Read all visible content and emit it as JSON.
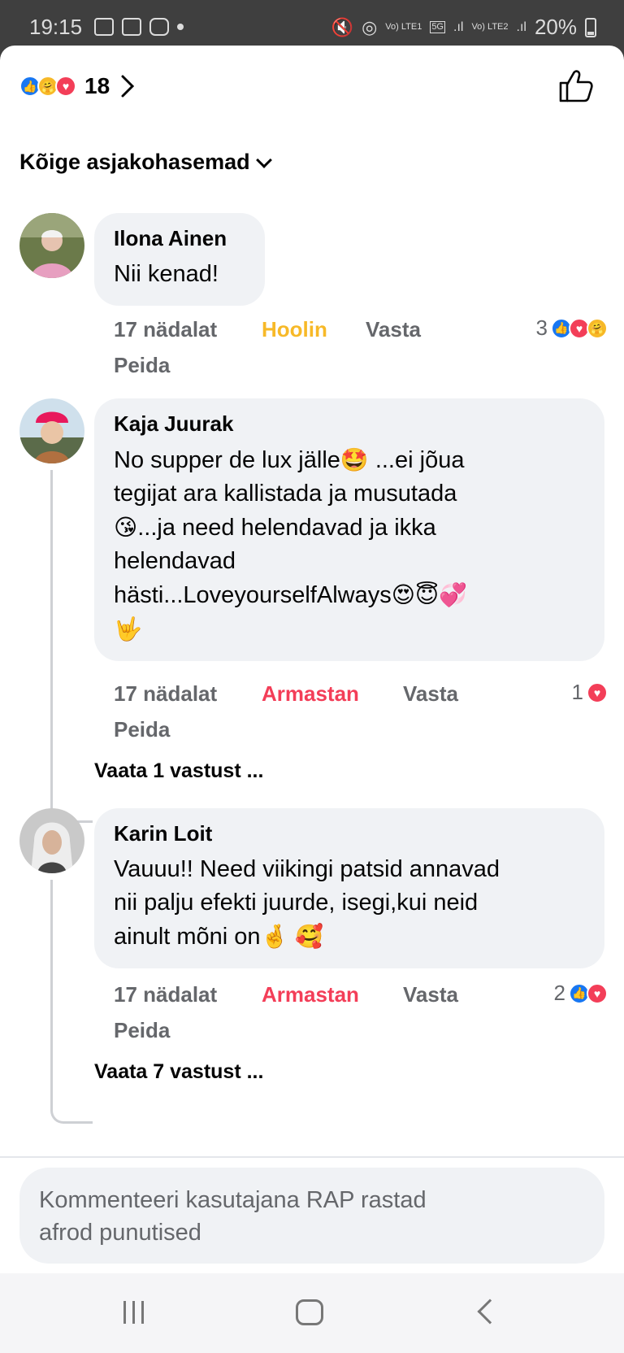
{
  "status_bar": {
    "time": "19:15",
    "net_1": "Vo) LTE1",
    "net_2": "Vo) LTE2",
    "five_g": "5G",
    "battery": "20%"
  },
  "header": {
    "reaction_count": "18"
  },
  "sort_label": "Kõige asjakohasemad",
  "comments": [
    {
      "name": "Ilona Ainen",
      "text": "Nii kenad!",
      "time": "17 nädalat",
      "reaction_label": "Hoolin",
      "reply": "Vasta",
      "hide": "Peida",
      "reaction_total": "3"
    },
    {
      "name": "Kaja Juurak",
      "text_1": "No supper de lux jälle",
      "text_2": " ...ei jõua",
      "text_3": "tegijat ara kallistada ja musutada",
      "text_4": "...ja need helendavad ja ikka",
      "text_5": "helendavad",
      "text_6": "hästi...LoveyourselfAlways",
      "time": "17 nädalat",
      "reaction_label": "Armastan",
      "reply": "Vasta",
      "hide": "Peida",
      "reaction_total": "1",
      "view_replies": "Vaata 1 vastust ..."
    },
    {
      "name": "Karin Loit",
      "text_1": "Vauuu!! Need viikingi patsid annavad",
      "text_2": "nii palju efekti juurde, isegi,kui neid",
      "text_3": "ainult mõni on",
      "time": "17 nädalat",
      "reaction_label": "Armastan",
      "reply": "Vasta",
      "hide": "Peida",
      "reaction_total": "2",
      "view_replies": "Vaata 7 vastust ..."
    }
  ],
  "composer": {
    "placeholder_1": "Kommenteeri kasutajana RAP rastad",
    "placeholder_2": "afrod punutised"
  },
  "colors": {
    "like": "#1877f2",
    "love": "#f33e58",
    "care": "#f7b928",
    "bubble": "#f0f2f5"
  },
  "icons": [
    "like-reaction-icon",
    "care-reaction-icon",
    "love-reaction-icon",
    "thumbs-up-icon",
    "chevron-right-icon",
    "chevron-down-icon",
    "recent-apps-icon",
    "home-icon",
    "back-icon"
  ]
}
